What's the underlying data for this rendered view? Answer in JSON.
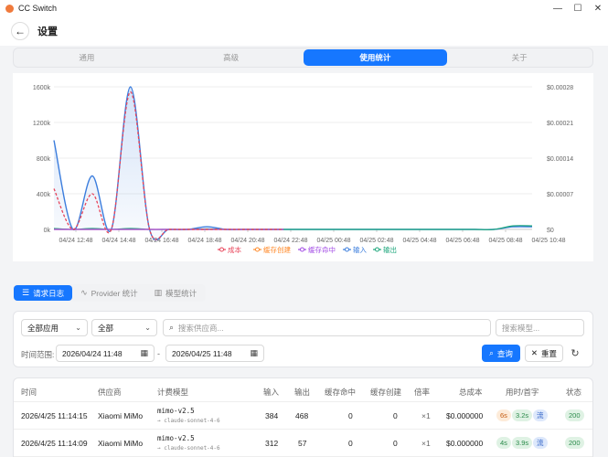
{
  "window": {
    "title": "CC Switch",
    "minimize": "—",
    "maximize": "☐",
    "close": "✕"
  },
  "header": {
    "back": "←",
    "title": "设置"
  },
  "tabs": [
    {
      "label": "通用",
      "active": false
    },
    {
      "label": "高级",
      "active": false
    },
    {
      "label": "使用统计",
      "active": true
    },
    {
      "label": "关于",
      "active": false
    }
  ],
  "chart_data": {
    "type": "line",
    "left_axis_ticks": [
      "1600k",
      "1200k",
      "800k",
      "400k",
      "0k"
    ],
    "right_axis_ticks": [
      "$0.00028",
      "$0.00021",
      "$0.00014",
      "$0.00007",
      "$0"
    ],
    "x_tick_labels": [
      "04/24 12:48",
      "04/24 14:48",
      "04/24 16:48",
      "04/24 18:48",
      "04/24 20:48",
      "04/24 22:48",
      "04/25 00:48",
      "04/25 02:48",
      "04/25 04:48",
      "04/25 06:48",
      "04/25 08:48",
      "04/25 10:48"
    ],
    "left_ylim": [
      0,
      1600000
    ],
    "right_ylim": [
      0,
      0.00028
    ],
    "grid": true,
    "legend_position": "bottom",
    "series": [
      {
        "name": "成本",
        "color": "#e8445a",
        "axis": "right",
        "style": "dashed",
        "points": [
          [
            0,
            8e-05
          ],
          [
            1,
            0.0
          ],
          [
            2,
            7e-05
          ],
          [
            3,
            0.0
          ],
          [
            4,
            0.00027
          ],
          [
            5,
            0.0
          ],
          [
            6,
            0.0
          ],
          [
            7,
            0.0
          ],
          [
            8,
            0.0
          ],
          [
            9,
            0.0
          ],
          [
            10,
            0.0
          ],
          [
            11,
            0.0
          ],
          [
            12,
            0.0
          ]
        ]
      },
      {
        "name": "缓存创建",
        "color": "#ff8a2a",
        "axis": "left",
        "style": "solid",
        "points": [
          [
            0,
            0
          ],
          [
            12,
            0
          ]
        ]
      },
      {
        "name": "缓存命中",
        "color": "#a24be5",
        "axis": "left",
        "style": "solid",
        "points": [
          [
            0,
            0
          ],
          [
            12,
            0
          ]
        ]
      },
      {
        "name": "输入",
        "color": "#3b7ddd",
        "axis": "left",
        "style": "area",
        "points": [
          [
            0,
            1000000
          ],
          [
            1,
            0
          ],
          [
            2,
            600000
          ],
          [
            3,
            0
          ],
          [
            4,
            1600000
          ],
          [
            5,
            0
          ],
          [
            6,
            0
          ],
          [
            7,
            0
          ],
          [
            8,
            30000
          ],
          [
            9,
            0
          ],
          [
            10,
            0
          ],
          [
            11,
            0
          ],
          [
            12,
            0
          ],
          [
            13,
            0
          ],
          [
            14,
            0
          ],
          [
            15,
            0
          ],
          [
            16,
            0
          ],
          [
            17,
            0
          ],
          [
            18,
            0
          ],
          [
            19,
            0
          ],
          [
            20,
            0
          ],
          [
            21,
            0
          ],
          [
            22,
            0
          ],
          [
            23,
            0
          ],
          [
            24,
            30000
          ],
          [
            25,
            30000
          ]
        ]
      },
      {
        "name": "输出",
        "color": "#1aa57a",
        "axis": "left",
        "style": "solid",
        "points": [
          [
            0,
            10000
          ],
          [
            1,
            0
          ],
          [
            2,
            10000
          ],
          [
            3,
            0
          ],
          [
            4,
            10000
          ],
          [
            5,
            0
          ],
          [
            6,
            0
          ],
          [
            7,
            0
          ],
          [
            8,
            5000
          ],
          [
            9,
            0
          ],
          [
            10,
            0
          ],
          [
            11,
            0
          ],
          [
            12,
            0
          ],
          [
            13,
            0
          ],
          [
            14,
            0
          ],
          [
            15,
            0
          ],
          [
            16,
            0
          ],
          [
            17,
            0
          ],
          [
            18,
            0
          ],
          [
            19,
            0
          ],
          [
            20,
            0
          ],
          [
            21,
            0
          ],
          [
            22,
            0
          ],
          [
            23,
            0
          ],
          [
            24,
            40000
          ],
          [
            25,
            40000
          ]
        ]
      }
    ]
  },
  "subtabs": [
    {
      "label": "请求日志",
      "icon": "list-filter-icon",
      "active": true
    },
    {
      "label": "Provider 统计",
      "icon": "activity-icon",
      "active": false
    },
    {
      "label": "模型统计",
      "icon": "bar-chart-icon",
      "active": false
    }
  ],
  "filters": {
    "app_select": "全部应用",
    "status_select": "全部",
    "provider_placeholder": "搜索供应商...",
    "model_placeholder": "搜索模型...",
    "range_label": "时间范围:",
    "date_from": "2026/04/24 11:48",
    "date_to": "2026/04/25 11:48",
    "range_separator": "-",
    "query_button": "查询",
    "reset_button": "重置"
  },
  "table": {
    "headers": [
      "时间",
      "供应商",
      "计费模型",
      "输入",
      "输出",
      "缓存命中",
      "缓存创建",
      "倍率",
      "总成本",
      "用时/首字",
      "状态"
    ],
    "rows": [
      {
        "time": "2026/4/25 11:14:15",
        "provider": "Xiaomi MiMo",
        "model": "mimo-v2.5",
        "model_sub": "→ claude-sonnet-4-6",
        "input": "384",
        "output": "468",
        "cache_hit": "0",
        "cache_create": "0",
        "multiplier": "×1",
        "cost": "$0.000000",
        "duration": "6s",
        "first_token": "3.2s",
        "stream": "流",
        "status": "200"
      },
      {
        "time": "2026/4/25 11:14:09",
        "provider": "Xiaomi MiMo",
        "model": "mimo-v2.5",
        "model_sub": "→ claude-sonnet-4-6",
        "input": "312",
        "output": "57",
        "cache_hit": "0",
        "cache_create": "0",
        "multiplier": "×1",
        "cost": "$0.000000",
        "duration": "4s",
        "first_token": "3.9s",
        "stream": "流",
        "status": "200"
      }
    ]
  }
}
